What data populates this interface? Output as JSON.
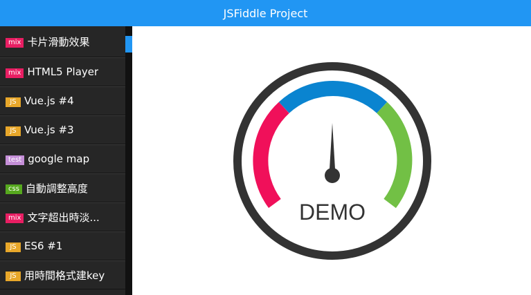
{
  "header": {
    "title": "JSFiddle Project"
  },
  "sidebar": {
    "items": [
      {
        "badge": "mix",
        "badge_color": "#e91e63",
        "label": "卡片滑動效果"
      },
      {
        "badge": "mix",
        "badge_color": "#e91e63",
        "label": "HTML5 Player"
      },
      {
        "badge": "JS",
        "badge_color": "#e8a72a",
        "label": "Vue.js #4"
      },
      {
        "badge": "JS",
        "badge_color": "#e8a72a",
        "label": "Vue.js #3"
      },
      {
        "badge": "test",
        "badge_color": "#c58fd8",
        "label": "google map"
      },
      {
        "badge": "css",
        "badge_color": "#56a81e",
        "label": "自動調整高度"
      },
      {
        "badge": "mix",
        "badge_color": "#e91e63",
        "label": "文字超出時淡..."
      },
      {
        "badge": "JS",
        "badge_color": "#e8a72a",
        "label": "ES6 #1"
      },
      {
        "badge": "JS",
        "badge_color": "#e8a72a",
        "label": "用時間格式建key"
      }
    ]
  },
  "gauge": {
    "label": "DEMO",
    "colors": {
      "ring": "#333333",
      "left_segment": "#f0105a",
      "top_segment": "#0a84d0",
      "right_segment": "#72c045",
      "needle": "#333333"
    }
  }
}
